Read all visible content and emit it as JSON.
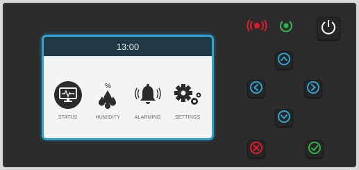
{
  "display": {
    "time": "13:00",
    "menu": [
      {
        "label": "STATUS",
        "icon": "monitor-icon"
      },
      {
        "label": "HUMIDITY",
        "icon": "humidity-icon"
      },
      {
        "label": "ALARMING",
        "icon": "bell-icon"
      },
      {
        "label": "SETTINGS",
        "icon": "gears-icon"
      }
    ]
  },
  "colors": {
    "accent": "#2fa4d4",
    "alarm": "#e11b2b",
    "ok": "#2fb24a",
    "panel": "#2c2c2c"
  },
  "controls": {
    "indicators": [
      "alarm-indicator-icon",
      "status-ok-indicator-icon"
    ],
    "buttons": [
      "power-icon",
      "up-arrow-icon",
      "left-arrow-icon",
      "right-arrow-icon",
      "down-arrow-icon",
      "cancel-icon",
      "confirm-icon"
    ]
  }
}
